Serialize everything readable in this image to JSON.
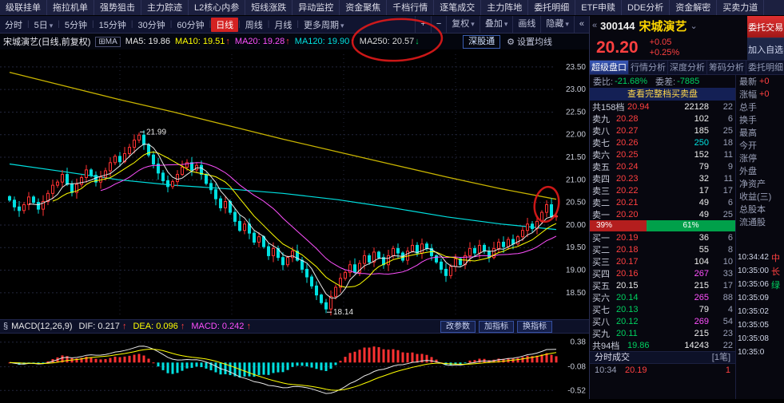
{
  "colors": {
    "up": "#ff3232",
    "down": "#00e0e0",
    "price_red": "#ff4040",
    "buy_green": "#00d060",
    "ma5": "#e8e8e8",
    "ma10": "#ffff00",
    "ma20": "#ff50ff",
    "ma120": "#00e0e0",
    "ma250": "#c8b400",
    "dif": "#e8e8e8",
    "dea": "#ffff00",
    "grid": "#23263c",
    "axis_text": "#c8ccd8",
    "pen": "#e11a1a"
  },
  "icons": {
    "collapse": "«",
    "caret_down": "⌄",
    "dropdown": "▾",
    "up_arrow": "↑",
    "down_arrow": "↓",
    "gear": "⚙",
    "section": "§",
    "ma_grid": "⊞",
    "plus": "+",
    "minus": "−"
  },
  "top_menu": {
    "items": [
      "级联挂单",
      "拖拉机单",
      "强势狙击",
      "主力踪迹",
      "L2核心内参",
      "短线涨跌",
      "异动监控",
      "资金聚焦",
      "千档行情",
      "逐笔成交",
      "主力阵地",
      "委托明细",
      "ETF申赎",
      "DDE分析",
      "资金解密",
      "买卖力道"
    ]
  },
  "toolbar": {
    "periods": [
      {
        "label": "分时"
      },
      {
        "label": "5日",
        "caret": true
      },
      {
        "label": "5分钟"
      },
      {
        "label": "15分钟"
      },
      {
        "label": "30分钟"
      },
      {
        "label": "60分钟"
      },
      {
        "label": "日线",
        "active": true
      },
      {
        "label": "周线"
      },
      {
        "label": "月线"
      },
      {
        "label": "更多周期",
        "caret": true
      }
    ],
    "right_buttons": [
      {
        "label": "+"
      },
      {
        "label": "−"
      },
      {
        "label": "复权",
        "caret": true
      },
      {
        "label": "叠加",
        "caret": true
      },
      {
        "label": "画线"
      },
      {
        "label": "隐藏",
        "caret": true
      }
    ]
  },
  "chart_header": {
    "title": "宋城演艺(日线,前复权)",
    "ma_toggle": "MA",
    "ma_items": [
      {
        "key": "ma5",
        "label": "MA5:",
        "value": "19.86",
        "arrow": "",
        "color": "#e8e8e8"
      },
      {
        "key": "ma10",
        "label": "MA10:",
        "value": "19.51",
        "arrow": "↑",
        "color": "#ffff00"
      },
      {
        "key": "ma20",
        "label": "MA20:",
        "value": "19.28",
        "arrow": "↑",
        "color": "#ff50ff"
      },
      {
        "key": "ma120",
        "label": "MA120:",
        "value": "19.90",
        "arrow": "↑",
        "color": "#00e0e0"
      },
      {
        "key": "ma250",
        "label": "MA250:",
        "value": "20.57",
        "arrow": "↓",
        "color": "#d8d8d8"
      }
    ],
    "right_buttons": [
      {
        "label": "深股通",
        "style": "blue"
      },
      {
        "label": "设置均线",
        "gear": true
      }
    ]
  },
  "chart_data": {
    "type": "candlestick",
    "title": "宋城演艺 日线 前复权",
    "ylabels": [
      "23.50",
      "23.00",
      "22.50",
      "22.00",
      "21.50",
      "21.00",
      "20.50",
      "20.00",
      "19.50",
      "19.00",
      "18.50"
    ],
    "ylim": [
      18.02,
      23.78
    ],
    "closes": [
      20.55,
      20.4,
      20.32,
      20.45,
      20.62,
      20.5,
      20.35,
      20.52,
      20.7,
      20.88,
      20.95,
      21.12,
      20.9,
      20.72,
      20.9,
      21.05,
      21.22,
      21.1,
      20.95,
      21.06,
      21.2,
      21.38,
      21.52,
      21.4,
      21.58,
      21.72,
      21.88,
      21.99,
      21.78,
      21.55,
      21.35,
      21.15,
      20.98,
      20.85,
      20.96,
      21.12,
      21.28,
      21.38,
      21.22,
      21.32,
      21.12,
      20.92,
      20.78,
      20.58,
      20.38,
      20.52,
      20.28,
      20.08,
      19.88,
      20.02,
      19.82,
      19.62,
      19.74,
      19.52,
      19.32,
      19.48,
      19.28,
      19.12,
      19.28,
      19.42,
      19.22,
      19.02,
      18.85,
      18.65,
      18.45,
      18.28,
      18.14,
      18.42,
      18.62,
      18.82,
      18.95,
      19.12,
      18.95,
      19.15,
      19.32,
      19.18,
      19.4,
      19.28,
      19.12,
      19.32,
      19.48,
      19.38,
      19.22,
      19.42,
      19.55,
      19.38,
      19.58,
      19.48,
      19.32,
      19.18,
      19.02,
      18.88,
      19.08,
      19.25,
      19.12,
      19.32,
      19.48,
      19.38,
      19.55,
      19.42,
      19.28,
      19.48,
      19.62,
      19.52,
      19.68,
      19.58,
      19.74,
      19.88,
      20.02,
      19.92,
      20.08,
      20.28,
      20.45,
      20.18,
      20.2
    ],
    "ma250_points": [
      [
        0,
        23.38
      ],
      [
        0.1,
        23.08
      ],
      [
        0.2,
        22.78
      ],
      [
        0.3,
        22.5
      ],
      [
        0.4,
        22.2
      ],
      [
        0.5,
        21.9
      ],
      [
        0.6,
        21.62
      ],
      [
        0.7,
        21.34
      ],
      [
        0.8,
        21.06
      ],
      [
        0.9,
        20.8
      ],
      [
        1,
        20.57
      ]
    ],
    "ma120_points": [
      [
        0,
        21.35
      ],
      [
        0.1,
        21.18
      ],
      [
        0.2,
        21.0
      ],
      [
        0.3,
        20.88
      ],
      [
        0.4,
        20.8
      ],
      [
        0.5,
        20.7
      ],
      [
        0.6,
        20.56
      ],
      [
        0.7,
        20.38
      ],
      [
        0.8,
        20.18
      ],
      [
        0.9,
        20.02
      ],
      [
        1,
        19.9
      ]
    ],
    "annotations": [
      {
        "text": "21.99",
        "bar": 27,
        "price": 21.99,
        "pos": "above"
      },
      {
        "text": "18.14",
        "bar": 66,
        "price": 18.14,
        "pos": "below"
      }
    ]
  },
  "macd": {
    "section_icon": "§",
    "title": "MACD(12,26,9)",
    "dif_label": "DIF:",
    "dif_value": "0.217",
    "dea_label": "DEA:",
    "dea_value": "0.096",
    "macd_label": "MACD:",
    "macd_value": "0.242",
    "buttons": [
      "改参数",
      "加指标",
      "换指标"
    ],
    "axis_labels": [
      {
        "text": "0.38",
        "value": 0.38
      },
      {
        "text": "-0.08",
        "value": -0.08
      },
      {
        "text": "-0.52",
        "value": -0.52
      }
    ],
    "ylim": [
      -0.62,
      0.48
    ]
  },
  "quote_panel": {
    "code": "300144",
    "name": "宋城演艺",
    "price": "20.20",
    "change": "+0.05",
    "change_pct": "+0.25%",
    "buttons": {
      "trade": "委托交易",
      "add": "加入自选"
    },
    "tabs": [
      {
        "label": "超级盘口",
        "active": true
      },
      {
        "label": "行情分析"
      },
      {
        "label": "深度分析"
      },
      {
        "label": "筹码分析"
      },
      {
        "label": "委托明细"
      }
    ],
    "weibi_label": "委比:",
    "weibi": "-21.68%",
    "weicha_label": "委差:",
    "weicha": "-7885",
    "link": "查看完整档买卖盘",
    "sell_total": {
      "label": "共158档",
      "price": "20.94",
      "vol": "22128",
      "cnt": "22"
    },
    "sells": [
      {
        "label": "卖九",
        "price": "20.28",
        "vol": "102",
        "cnt": "6"
      },
      {
        "label": "卖八",
        "price": "20.27",
        "vol": "185",
        "cnt": "25"
      },
      {
        "label": "卖七",
        "price": "20.26",
        "vol": "250",
        "cnt": "18",
        "vc": "cyan"
      },
      {
        "label": "卖六",
        "price": "20.25",
        "vol": "152",
        "cnt": "11"
      },
      {
        "label": "卖五",
        "price": "20.24",
        "vol": "79",
        "cnt": "9"
      },
      {
        "label": "卖四",
        "price": "20.23",
        "vol": "32",
        "cnt": "11"
      },
      {
        "label": "卖三",
        "price": "20.22",
        "vol": "17",
        "cnt": "17"
      },
      {
        "label": "卖二",
        "price": "20.21",
        "vol": "49",
        "cnt": "6"
      },
      {
        "label": "卖一",
        "price": "20.20",
        "vol": "49",
        "cnt": "25"
      }
    ],
    "ratio": {
      "buy_pct": "39%",
      "sell_pct": "61%",
      "buy_width": 39
    },
    "buys": [
      {
        "label": "买一",
        "price": "20.19",
        "vol": "36",
        "cnt": "6",
        "pc": "r"
      },
      {
        "label": "买二",
        "price": "20.18",
        "vol": "55",
        "cnt": "8",
        "pc": "r"
      },
      {
        "label": "买三",
        "price": "20.17",
        "vol": "104",
        "cnt": "10",
        "pc": "r"
      },
      {
        "label": "买四",
        "price": "20.16",
        "vol": "267",
        "cnt": "33",
        "pc": "r",
        "vc": "magenta"
      },
      {
        "label": "买五",
        "price": "20.15",
        "vol": "215",
        "cnt": "17",
        "pc": "w"
      },
      {
        "label": "买六",
        "price": "20.14",
        "vol": "265",
        "cnt": "88",
        "pc": "g",
        "vc": "magenta"
      },
      {
        "label": "买七",
        "price": "20.13",
        "vol": "79",
        "cnt": "4",
        "pc": "g"
      },
      {
        "label": "买八",
        "price": "20.12",
        "vol": "269",
        "cnt": "54",
        "pc": "g",
        "vc": "magenta"
      },
      {
        "label": "买九",
        "price": "20.11",
        "vol": "215",
        "cnt": "23",
        "pc": "g"
      }
    ],
    "buy_total": {
      "label": "共94档",
      "price": "19.86",
      "vol": "14243",
      "cnt": "22"
    },
    "fscj": {
      "title": "分时成交",
      "count": "[1笔]"
    },
    "trades": [
      {
        "time": "10:34",
        "price": "20.19",
        "vol": "1"
      }
    ]
  },
  "right_info": {
    "rows": [
      {
        "label": "最新",
        "value": "+0",
        "vc": "r"
      },
      {
        "label": "涨幅",
        "value": "+0",
        "vc": "r"
      },
      {
        "label": "总手",
        "value": ""
      },
      {
        "label": "换手",
        "value": ""
      },
      {
        "label": "最高",
        "value": ""
      },
      {
        "label": "今开",
        "value": ""
      },
      {
        "label": "涨停",
        "value": ""
      },
      {
        "label": "外盘",
        "value": ""
      },
      {
        "label": "净资产",
        "value": ""
      },
      {
        "label": "收益(三)",
        "value": ""
      },
      {
        "label": "总股本",
        "value": ""
      },
      {
        "label": "流通股",
        "value": ""
      }
    ],
    "times": [
      {
        "time": "10:34:42",
        "tag": "中",
        "tc": "r"
      },
      {
        "time": "10:35:00",
        "tag": "长",
        "tc": "r"
      },
      {
        "time": "10:35:06",
        "tag": "绿",
        "tc": "g"
      },
      {
        "time": "10:35:09",
        "tag": "",
        "tc": ""
      },
      {
        "time": "10:35:02",
        "tag": "",
        "tc": ""
      },
      {
        "time": "10:35:05",
        "tag": "",
        "tc": ""
      },
      {
        "time": "10:35:08",
        "tag": "",
        "tc": ""
      },
      {
        "time": "10:35:0",
        "tag": "",
        "tc": ""
      }
    ]
  }
}
